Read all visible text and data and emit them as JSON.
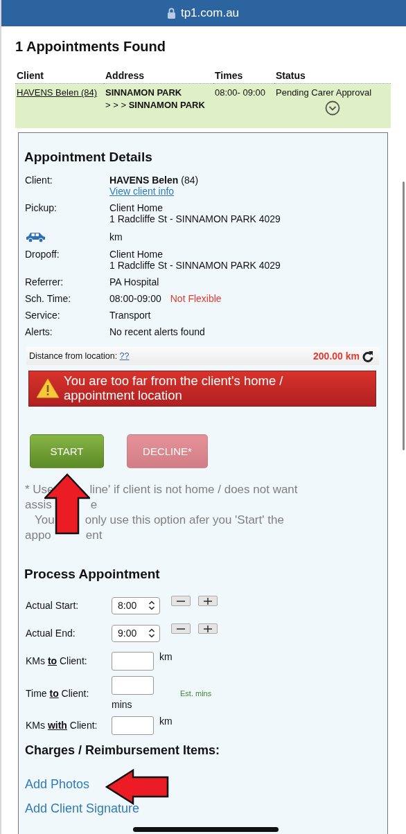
{
  "browser_bar": {
    "url": "tp1.com.au"
  },
  "results": {
    "heading": "1 Appointments Found",
    "columns": [
      "Client",
      "Address",
      "Times",
      "Status"
    ],
    "rows": [
      {
        "client": "HAVENS Belen (84)",
        "address_from": "SINNAMON PARK",
        "address_prefix": "> > >",
        "address_to": "SINNAMON PARK",
        "times": "08:00- 09:00",
        "status": "Pending Carer Approval"
      }
    ]
  },
  "details": {
    "heading": "Appointment Details",
    "rows": [
      {
        "kind": "client",
        "label": "Client:",
        "name": "HAVENS Belen",
        "age": "(84)",
        "link": "View client info"
      },
      {
        "kind": "text",
        "label": "Pickup:",
        "lines": [
          "Client Home",
          "1 Radcliffe St - SINNAMON PARK 4029"
        ]
      },
      {
        "kind": "car",
        "lines": [
          "km"
        ]
      },
      {
        "kind": "text",
        "label": "Dropoff:",
        "lines": [
          "Client Home",
          "1 Radcliffe St - SINNAMON PARK 4029"
        ]
      },
      {
        "kind": "text",
        "label": "Referrer:",
        "lines": [
          "PA Hospital"
        ]
      },
      {
        "kind": "flag",
        "label": "Sch. Time:",
        "lines": [
          "08:00-09:00"
        ],
        "flag": "Not Flexible"
      },
      {
        "kind": "text",
        "label": "Service:",
        "lines": [
          "Transport"
        ]
      },
      {
        "kind": "text",
        "label": "Alerts:",
        "lines": [
          "No recent alerts found"
        ]
      }
    ],
    "distance": {
      "label": "Distance from location:",
      "link": "??",
      "value": "200.00 km"
    },
    "alert": "You are too far from the client's home / appointment location",
    "buttons": [
      {
        "label": "START",
        "kind": "start",
        "disabled": false
      },
      {
        "label": "DECLINE*",
        "kind": "decline",
        "disabled": true
      }
    ],
    "note": [
      [
        "* Use",
        "line' if client is not home / does not want"
      ],
      [
        "assis",
        "e"
      ],
      [
        "You",
        "only use this option afer you 'Start' the"
      ],
      [
        "appo",
        "ent"
      ]
    ]
  },
  "process": {
    "heading": "Process Appointment",
    "fields": [
      {
        "kind": "time",
        "label": "Actual Start:",
        "value": "8:00"
      },
      {
        "kind": "time",
        "label": "Actual End:",
        "value": "9:00"
      },
      {
        "kind": "number",
        "label": "KMs **to** Client:",
        "unit": "km"
      },
      {
        "kind": "number",
        "label": "Time **to** Client:",
        "unit": "mins",
        "hint": "Est. mins"
      },
      {
        "kind": "number",
        "label": "KMs **with** Client:",
        "unit": "km"
      }
    ]
  },
  "charges": {
    "heading": "Charges / Reimbursement Items:",
    "links": [
      "Add Photos",
      "Add Client Signature"
    ]
  }
}
